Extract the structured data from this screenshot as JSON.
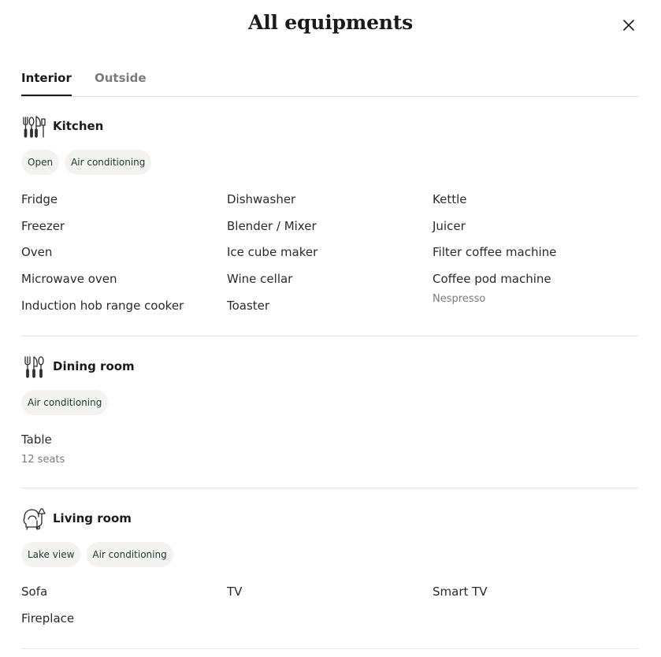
{
  "dialog": {
    "title": "All equipments",
    "close_icon": "close-icon"
  },
  "tabs": [
    {
      "label": "Interior",
      "active": true
    },
    {
      "label": "Outside",
      "active": false
    }
  ],
  "sections": {
    "kitchen": {
      "icon": "kitchen-utensils-icon",
      "title": "Kitchen",
      "chips": [
        "Open",
        "Air conditioning"
      ],
      "items": {
        "fridge": "Fridge",
        "freezer": "Freezer",
        "oven": "Oven",
        "microwave": "Microwave oven",
        "induction": "Induction hob range cooker",
        "dishwasher": "Dishwasher",
        "blender": "Blender / Mixer",
        "ice_cube": "Ice cube maker",
        "wine_cellar": "Wine cellar",
        "toaster": "Toaster",
        "kettle": "Kettle",
        "juicer": "Juicer",
        "filter_coffee": "Filter coffee machine",
        "coffee_pod": "Coffee pod machine",
        "coffee_pod_note": "Nespresso"
      }
    },
    "dining": {
      "icon": "cutlery-icon",
      "title": "Dining room",
      "chips": [
        "Air conditioning"
      ],
      "items": {
        "table": "Table",
        "table_note": "12 seats"
      }
    },
    "living": {
      "icon": "armchair-lamp-icon",
      "title": "Living room",
      "chips": [
        "Lake view",
        "Air conditioning"
      ],
      "items": {
        "sofa": "Sofa",
        "tv": "TV",
        "smart_tv": "Smart TV",
        "fireplace": "Fireplace"
      }
    }
  }
}
